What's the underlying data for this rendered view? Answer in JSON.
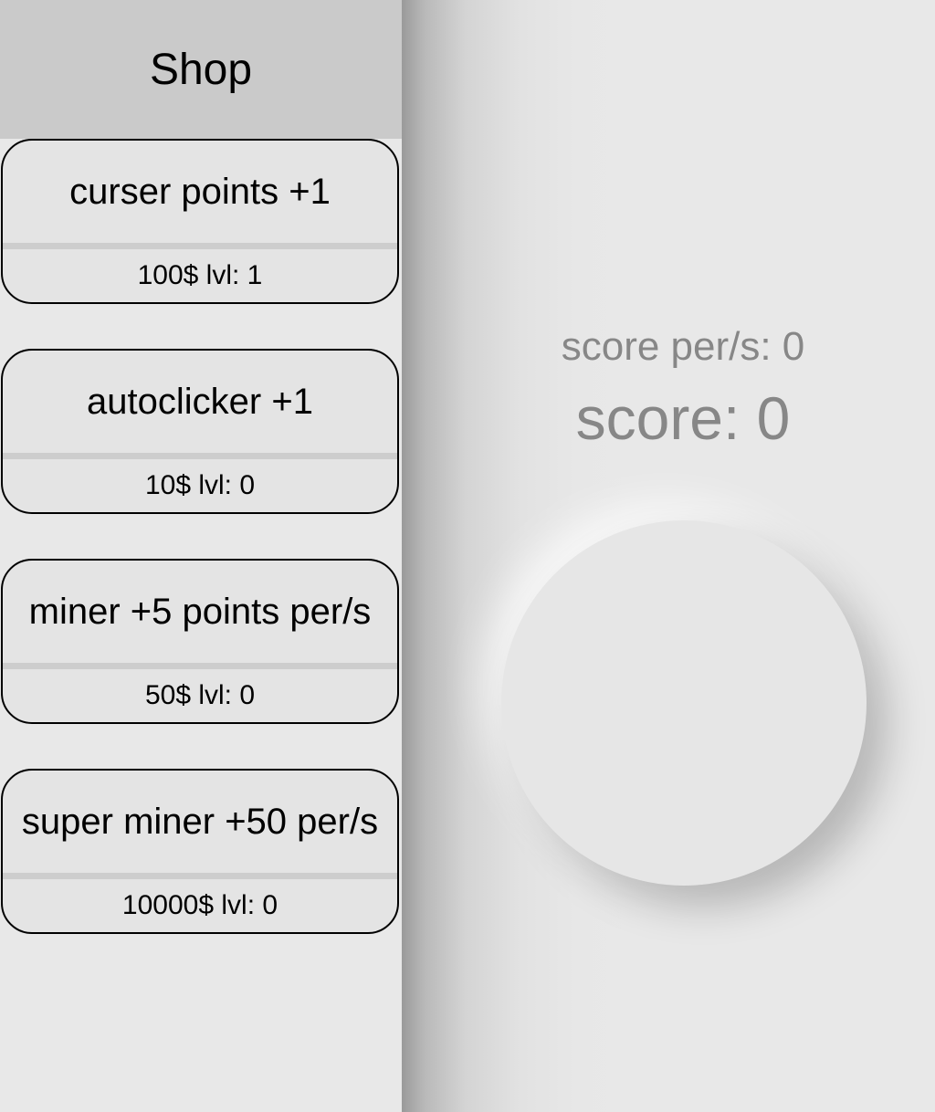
{
  "shop": {
    "title": "Shop",
    "items": [
      {
        "name": "curser points +1",
        "price": "100$",
        "level": "lvl: 1",
        "meta": "100$ lvl: 1"
      },
      {
        "name": "autoclicker +1",
        "price": "10$",
        "level": "lvl: 0",
        "meta": "10$ lvl: 0"
      },
      {
        "name": "miner +5 points per/s",
        "price": "50$",
        "level": "lvl: 0",
        "meta": "50$ lvl: 0"
      },
      {
        "name": "super miner +50 per/s",
        "price": "10000$",
        "level": "lvl: 0",
        "meta": "10000$ lvl: 0"
      }
    ]
  },
  "game": {
    "score_rate_text": "score per/s: 0",
    "score_text": "score: 0"
  },
  "colors": {
    "shop_header_bg": "#cacaca",
    "panel_bg": "#e8e8e8",
    "score_text": "#878787",
    "item_border": "#000000"
  }
}
